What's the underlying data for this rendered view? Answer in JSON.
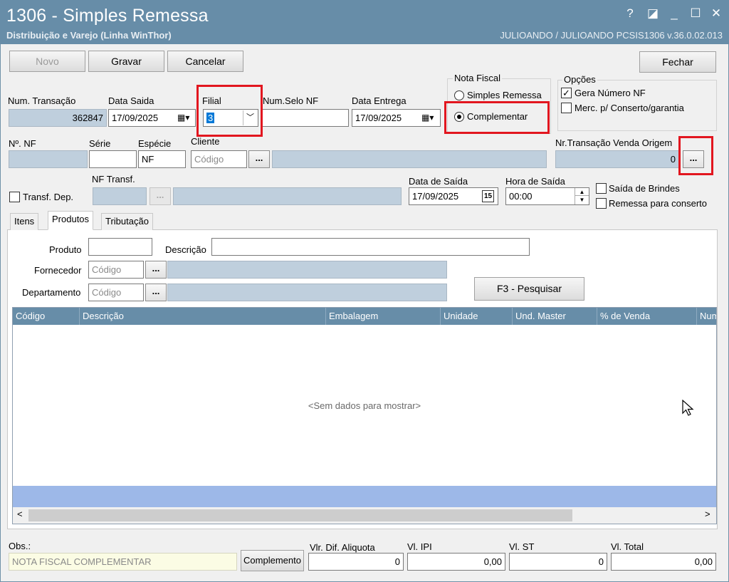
{
  "window": {
    "title": "1306 - Simples Remessa",
    "subtitle": "Distribuição e Varejo (Linha WinThor)",
    "user_info": "JULIOANDO / JULIOANDO    PCSIS1306  v.36.0.02.013",
    "controls": [
      "?",
      "◪",
      "_",
      "☐",
      "✕"
    ]
  },
  "toolbar": {
    "novo": "Novo",
    "gravar": "Gravar",
    "cancelar": "Cancelar",
    "fechar": "Fechar"
  },
  "header": {
    "num_transacao_label": "Num. Transação",
    "num_transacao": "362847",
    "data_saida_label": "Data Saida",
    "data_saida": "17/09/2025",
    "filial_label": "Filial",
    "filial": "3",
    "num_selo_label": "Num.Selo NF",
    "num_selo": "",
    "data_entrega_label": "Data Entrega",
    "data_entrega": "17/09/2025"
  },
  "nota_fiscal": {
    "legend": "Nota Fiscal",
    "options": [
      "Simples Remessa",
      "Complementar"
    ],
    "selected": "Complementar"
  },
  "opcoes": {
    "legend": "Opções",
    "gera_numero_nf": "Gera Número NF",
    "gera_numero_nf_checked": true,
    "merc_conserto": "Merc. p/ Conserto/garantia",
    "merc_conserto_checked": false
  },
  "row2": {
    "nf_label": "Nº. NF",
    "serie_label": "Série",
    "especie_label": "Espécie",
    "especie": "NF",
    "cliente_label": "Cliente",
    "cliente_placeholder": "Código",
    "nr_transacao_label": "Nr.Transação Venda Origem",
    "nr_transacao": "0",
    "ellipsis": "..."
  },
  "row3": {
    "transf_dep": "Transf. Dep.",
    "nf_transf_label": "NF Transf.",
    "data_de_saida_label": "Data de Saída",
    "data_de_saida": "17/09/2025",
    "calendar_glyph": "15",
    "hora_saida_label": "Hora de Saída",
    "hora_saida": "00:00",
    "saida_brindes": "Saída de Brindes",
    "remessa_conserto": "Remessa para conserto"
  },
  "tabs": [
    "Itens",
    "Produtos",
    "Tributação"
  ],
  "active_tab": "Produtos",
  "produtos": {
    "produto_label": "Produto",
    "descricao_label": "Descrição",
    "fornecedor_label": "Fornecedor",
    "fornecedor_placeholder": "Código",
    "departamento_label": "Departamento",
    "departamento_placeholder": "Código",
    "pesquisar": "F3 - Pesquisar"
  },
  "grid": {
    "columns": [
      "Código",
      "Descrição",
      "Embalagem",
      "Unidade",
      "Und. Master",
      "% de Venda",
      "Num"
    ],
    "empty_text": "<Sem dados para mostrar>",
    "scroll_left": "<",
    "scroll_right": ">"
  },
  "footer": {
    "obs_label": "Obs.:",
    "obs": "NOTA FISCAL COMPLEMENTAR",
    "complemento": "Complemento",
    "vlr_dif_aliquota_label": "Vlr. Dif. Aliquota",
    "vlr_dif_aliquota": "0",
    "vl_ipi_label": "Vl. IPI",
    "vl_ipi": "0,00",
    "vl_st_label": "Vl. ST",
    "vl_st": "0",
    "vl_total_label": "Vl. Total",
    "vl_total": "0,00"
  },
  "colors": {
    "title_bar": "#678da8",
    "readonly_field": "#bfcfdd",
    "highlight": "#e2161f",
    "grid_footer": "#9db8e8"
  }
}
